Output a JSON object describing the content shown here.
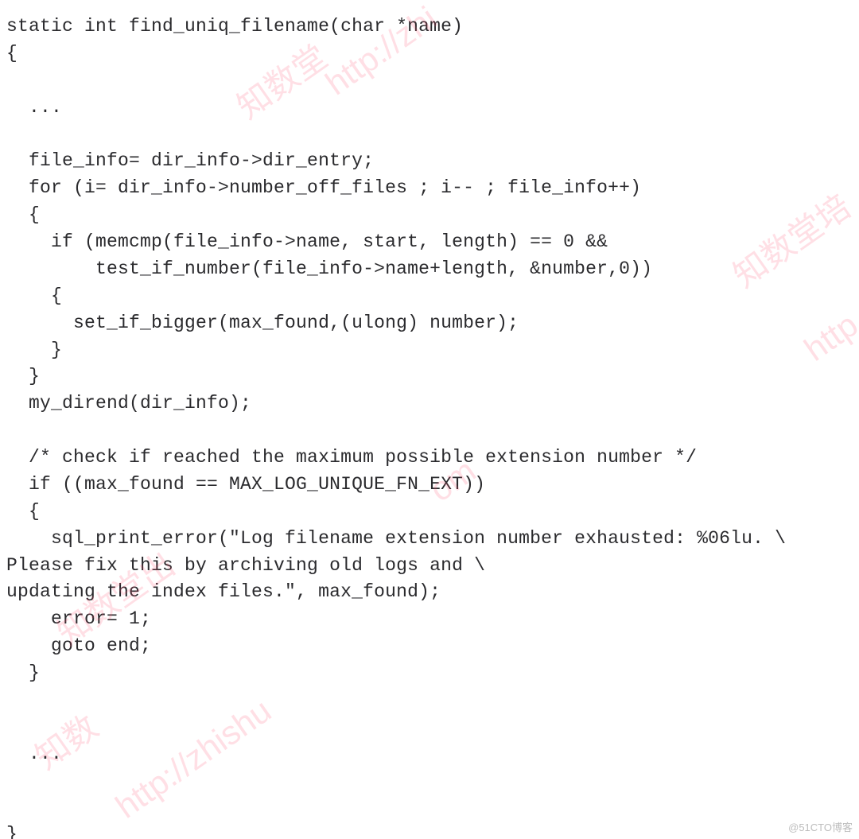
{
  "code": {
    "lines": [
      "static int find_uniq_filename(char *name)",
      "{",
      "",
      "  ...",
      "",
      "  file_info= dir_info->dir_entry;",
      "  for (i= dir_info->number_off_files ; i-- ; file_info++)",
      "  {",
      "    if (memcmp(file_info->name, start, length) == 0 &&",
      "        test_if_number(file_info->name+length, &number,0))",
      "    {",
      "      set_if_bigger(max_found,(ulong) number);",
      "    }",
      "  }",
      "  my_dirend(dir_info);",
      "",
      "  /* check if reached the maximum possible extension number */",
      "  if ((max_found == MAX_LOG_UNIQUE_FN_EXT))",
      "  {",
      "    sql_print_error(\"Log filename extension number exhausted: %06lu. \\",
      "Please fix this by archiving old logs and \\",
      "updating the index files.\", max_found);",
      "    error= 1;",
      "    goto end;",
      "  }",
      "",
      "",
      "  ...",
      "",
      "",
      "}"
    ]
  },
  "watermarks": {
    "w1": "知数堂",
    "w2": "http://zhi",
    "w3": "知数堂培",
    "w4": "http",
    "w5": "om",
    "w6": "知数堂出",
    "w7": "http://zhishu",
    "w8": "知数"
  },
  "attribution": "@51CTO博客"
}
